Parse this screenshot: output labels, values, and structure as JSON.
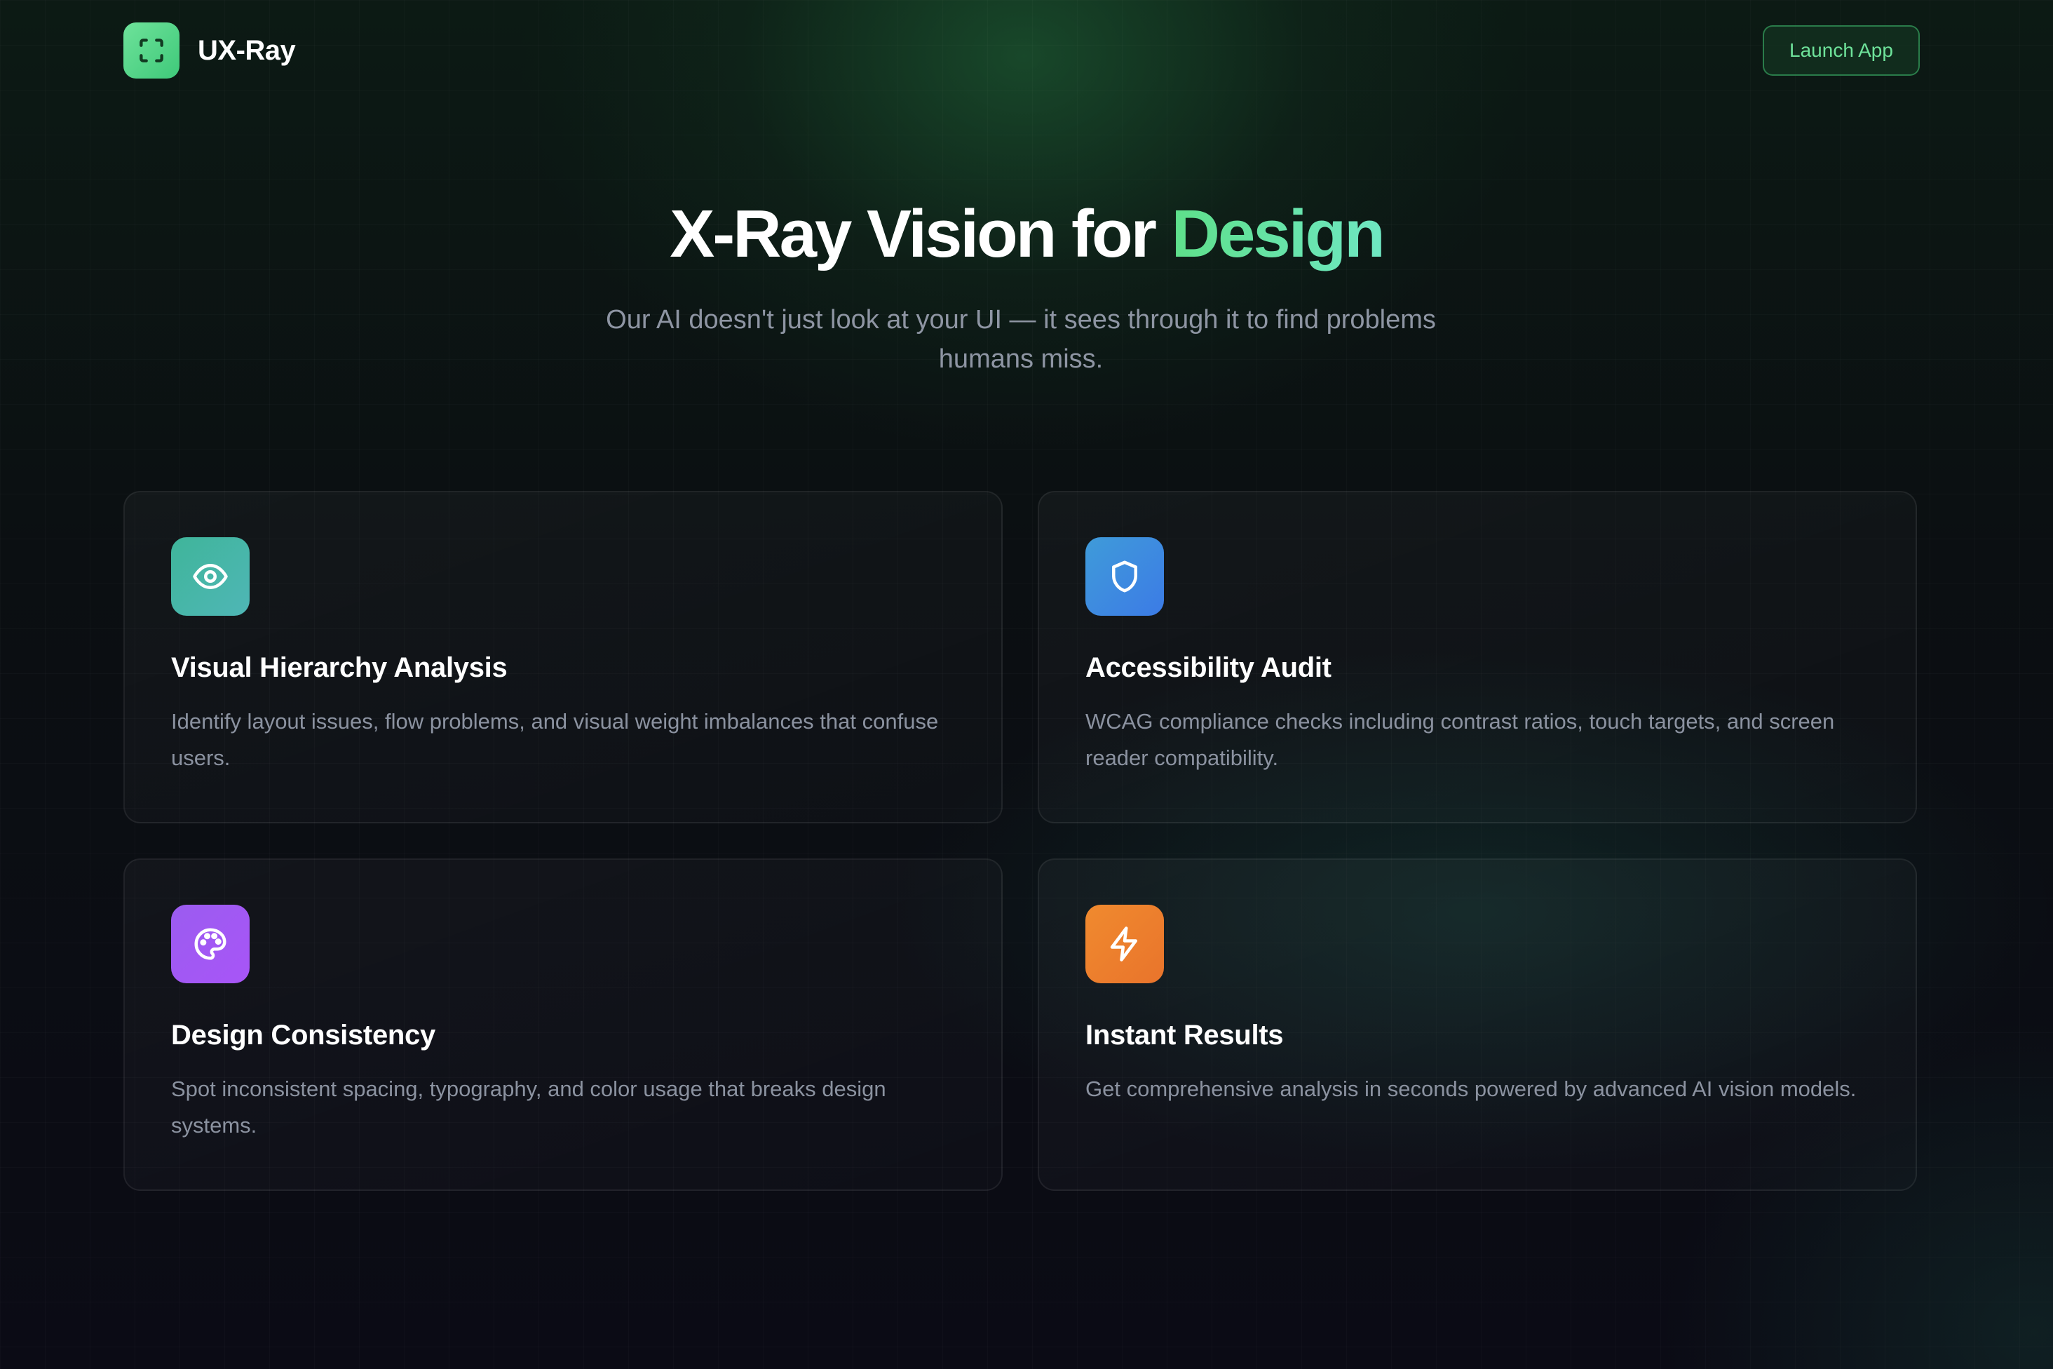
{
  "header": {
    "brand_name": "UX-Ray",
    "logo_icon": "scan-frame-icon",
    "launch_label": "Launch App"
  },
  "hero": {
    "title_main": "X-Ray Vision for ",
    "title_accent": "Design",
    "subtitle": "Our AI doesn't just look at your UI — it sees through it to find problems humans miss."
  },
  "features": [
    {
      "icon": "eye-icon",
      "title": "Visual Hierarchy Analysis",
      "description": "Identify layout issues, flow problems, and visual weight imbalances that confuse users."
    },
    {
      "icon": "shield-icon",
      "title": "Accessibility Audit",
      "description": "WCAG compliance checks including contrast ratios, touch targets, and screen reader compatibility."
    },
    {
      "icon": "palette-icon",
      "title": "Design Consistency",
      "description": "Spot inconsistent spacing, typography, and color usage that breaks design systems."
    },
    {
      "icon": "lightning-icon",
      "title": "Instant Results",
      "description": "Get comprehensive analysis in seconds powered by advanced AI vision models."
    }
  ],
  "colors": {
    "accent_green": "#4ade80",
    "background": "#0b0b13",
    "eye_icon_bg": "#45b5a5",
    "shield_icon_bg": "#3c86e2",
    "palette_icon_bg": "#a155f4",
    "lightning_icon_bg": "#ec7f2d"
  }
}
